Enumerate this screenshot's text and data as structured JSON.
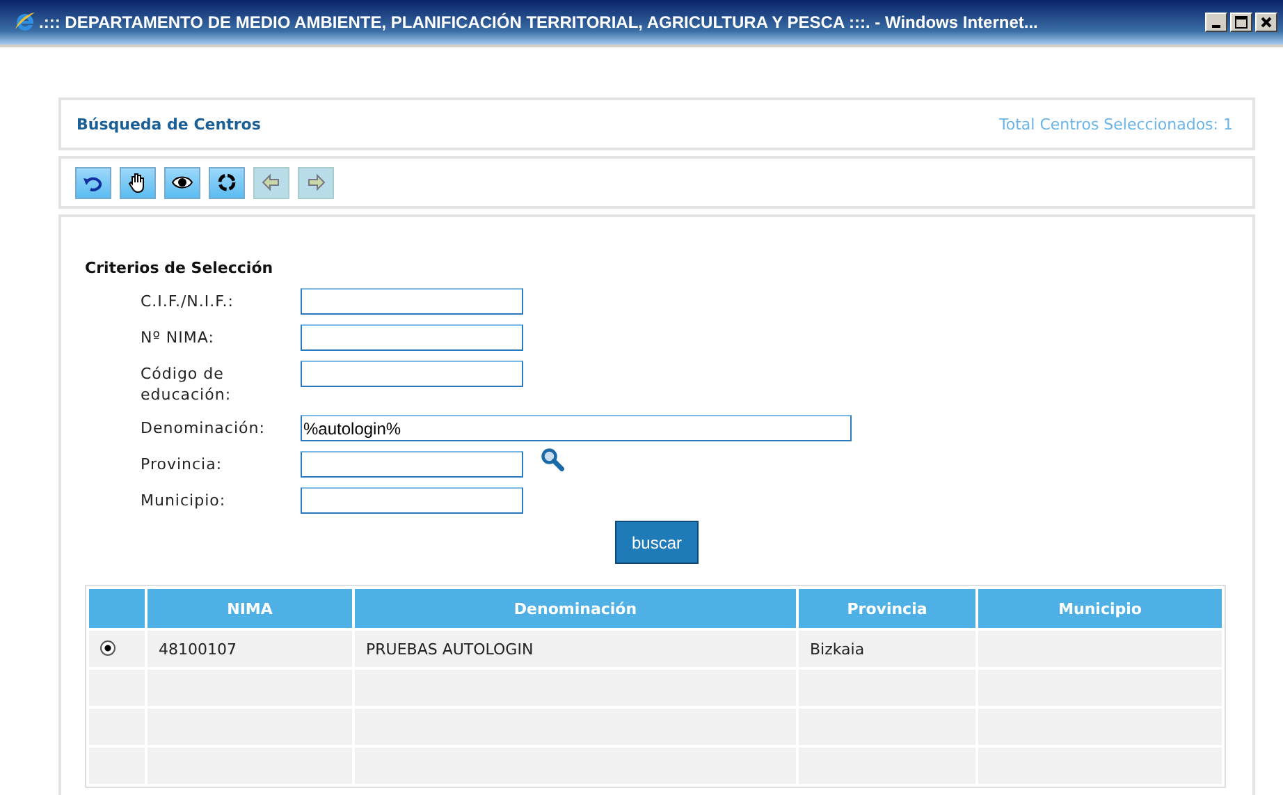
{
  "window": {
    "title": ".::: DEPARTAMENTO DE MEDIO AMBIENTE, PLANIFICACIÓN TERRITORIAL, AGRICULTURA Y PESCA :::. - Windows Internet..."
  },
  "header": {
    "title": "Búsqueda de Centros",
    "total": "Total Centros Seleccionados: 1"
  },
  "toolbar": [
    {
      "kind": "undo",
      "disabled": false
    },
    {
      "kind": "hand",
      "disabled": false
    },
    {
      "kind": "eye",
      "disabled": false
    },
    {
      "kind": "refresh",
      "disabled": false
    },
    {
      "kind": "back",
      "disabled": true
    },
    {
      "kind": "forward",
      "disabled": true
    }
  ],
  "criteria": {
    "title": "Criterios de Selección",
    "fields": [
      {
        "label": "C.I.F./N.I.F.:",
        "kind": "short"
      },
      {
        "label": "Nº NIMA:",
        "kind": "short"
      },
      {
        "label": "Código de educación:",
        "kind": "short"
      },
      {
        "label": "Denominación:",
        "kind": "long",
        "value": "%autologin%"
      },
      {
        "label": "Provincia:",
        "kind": "lookup"
      },
      {
        "label": "Municipio:",
        "kind": "short"
      }
    ],
    "button": "buscar"
  },
  "table": {
    "columns": [
      "NIMA",
      "Denominación",
      "Provincia",
      "Municipio"
    ],
    "rows": [
      {
        "kind": "data",
        "selected": true,
        "cells": [
          "48100107",
          "PRUEBAS AUTOLOGIN",
          "Bizkaia"
        ]
      },
      {
        "kind": "blank"
      },
      {
        "kind": "blank"
      },
      {
        "kind": "blank"
      }
    ]
  }
}
